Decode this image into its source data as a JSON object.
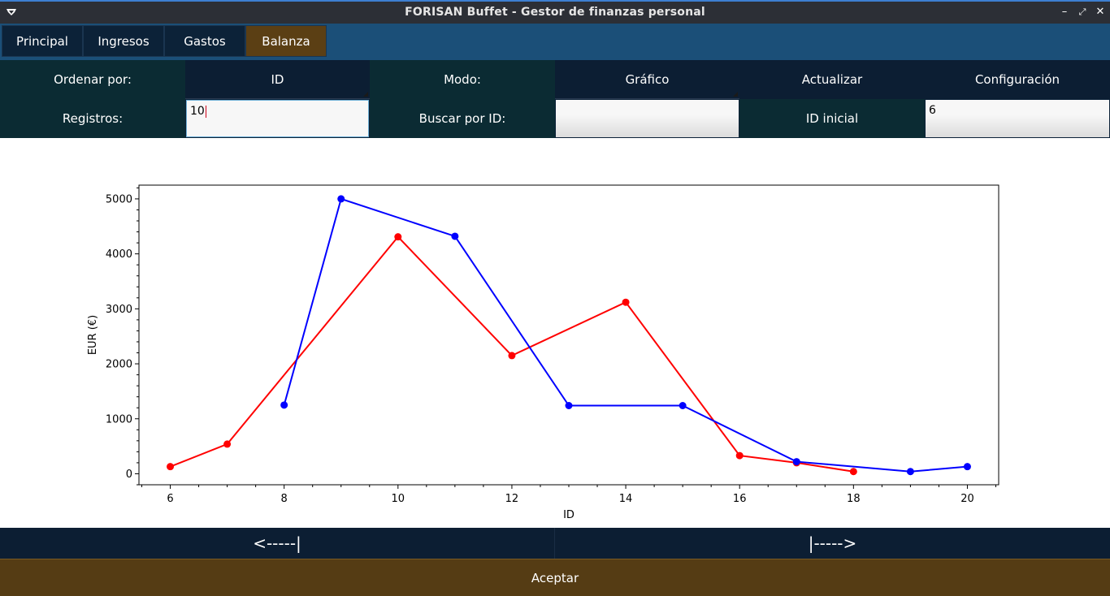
{
  "window": {
    "title": "FORISAN Buffet - Gestor de finanzas personal"
  },
  "tabs": [
    {
      "label": "Principal"
    },
    {
      "label": "Ingresos"
    },
    {
      "label": "Gastos"
    },
    {
      "label": "Balanza",
      "active": true
    }
  ],
  "controls": {
    "order_label": "Ordenar por:",
    "order_value": "ID",
    "mode_label": "Modo:",
    "mode_value": "Gráfico",
    "update_button": "Actualizar",
    "config_button": "Configuración",
    "records_label": "Registros:",
    "records_value": "10",
    "search_label": "Buscar por ID:",
    "search_value": "",
    "initial_id_label": "ID inicial",
    "initial_id_value": "6"
  },
  "chart_data": {
    "type": "line",
    "xlabel": "ID",
    "ylabel": "EUR (€)",
    "xlim": [
      5.45,
      20.55
    ],
    "ylim": [
      -200,
      5250
    ],
    "xticks": [
      6,
      8,
      10,
      12,
      14,
      16,
      18,
      20
    ],
    "yticks": [
      0,
      1000,
      2000,
      3000,
      4000,
      5000
    ],
    "grid": false,
    "series": [
      {
        "color": "#ff0000",
        "x": [
          6,
          7,
          10,
          12,
          14,
          16,
          17,
          18
        ],
        "y": [
          130,
          540,
          4310,
          2150,
          3120,
          330,
          200,
          40
        ]
      },
      {
        "color": "#0000ff",
        "x": [
          8,
          9,
          11,
          13,
          15,
          17,
          19,
          20
        ],
        "y": [
          1250,
          5000,
          4320,
          1240,
          1240,
          220,
          40,
          130
        ]
      }
    ]
  },
  "nav": {
    "prev_label": "<-----|",
    "next_label": "|----->"
  },
  "accept_label": "Aceptar"
}
